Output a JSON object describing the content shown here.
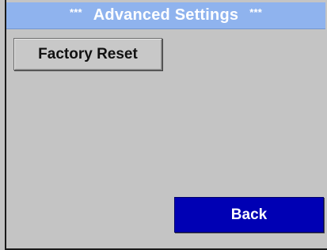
{
  "header": {
    "star_left": "***",
    "title": "Advanced Settings",
    "star_right": "***"
  },
  "buttons": {
    "factory_reset_label": "Factory Reset",
    "back_label": "Back"
  },
  "colors": {
    "title_bar": "#8fb3ee",
    "background": "#c4c4c4",
    "back_button": "#0000b4"
  }
}
